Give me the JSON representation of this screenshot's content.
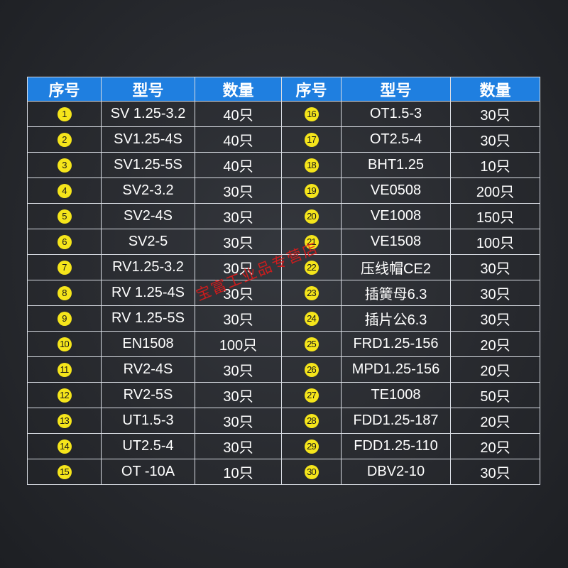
{
  "table": {
    "headers": [
      "序号",
      "型号",
      "数量",
      "序号",
      "型号",
      "数量"
    ],
    "rows": [
      {
        "no": "1",
        "model": "SV 1.25-3.2",
        "qty": "40只"
      },
      {
        "no": "2",
        "model": "SV1.25-4S",
        "qty": "40只"
      },
      {
        "no": "3",
        "model": "SV1.25-5S",
        "qty": "40只"
      },
      {
        "no": "4",
        "model": "SV2-3.2",
        "qty": "30只"
      },
      {
        "no": "5",
        "model": "SV2-4S",
        "qty": "30只"
      },
      {
        "no": "6",
        "model": "SV2-5",
        "qty": "30只"
      },
      {
        "no": "7",
        "model": "RV1.25-3.2",
        "qty": "30只"
      },
      {
        "no": "8",
        "model": "RV 1.25-4S",
        "qty": "30只"
      },
      {
        "no": "9",
        "model": "RV 1.25-5S",
        "qty": "30只"
      },
      {
        "no": "10",
        "model": "EN1508",
        "qty": "100只"
      },
      {
        "no": "11",
        "model": "RV2-4S",
        "qty": "30只"
      },
      {
        "no": "12",
        "model": "RV2-5S",
        "qty": "30只"
      },
      {
        "no": "13",
        "model": "UT1.5-3",
        "qty": "30只"
      },
      {
        "no": "14",
        "model": "UT2.5-4",
        "qty": "30只"
      },
      {
        "no": "15",
        "model": "OT -10A",
        "qty": "10只"
      },
      {
        "no": "16",
        "model": "OT1.5-3",
        "qty": "30只"
      },
      {
        "no": "17",
        "model": "OT2.5-4",
        "qty": "30只"
      },
      {
        "no": "18",
        "model": "BHT1.25",
        "qty": "10只"
      },
      {
        "no": "19",
        "model": "VE0508",
        "qty": "200只"
      },
      {
        "no": "20",
        "model": "VE1008",
        "qty": "150只"
      },
      {
        "no": "21",
        "model": "VE1508",
        "qty": "100只"
      },
      {
        "no": "22",
        "model": "压线帽CE2",
        "qty": "30只"
      },
      {
        "no": "23",
        "model": "插簧母6.3",
        "qty": "30只"
      },
      {
        "no": "24",
        "model": "插片公6.3",
        "qty": "30只"
      },
      {
        "no": "25",
        "model": "FRD1.25-156",
        "qty": "20只"
      },
      {
        "no": "26",
        "model": "MPD1.25-156",
        "qty": "20只"
      },
      {
        "no": "27",
        "model": "TE1008",
        "qty": "50只"
      },
      {
        "no": "28",
        "model": "FDD1.25-187",
        "qty": "20只"
      },
      {
        "no": "29",
        "model": "FDD1.25-110",
        "qty": "20只"
      },
      {
        "no": "30",
        "model": "DBV2-10",
        "qty": "30只"
      }
    ]
  },
  "watermark": "宝富工业品专营店",
  "colors": {
    "header_bg": "#1f7fe0",
    "badge": "#f5e51b",
    "watermark": "#e61919",
    "background": "#2a2c31"
  }
}
